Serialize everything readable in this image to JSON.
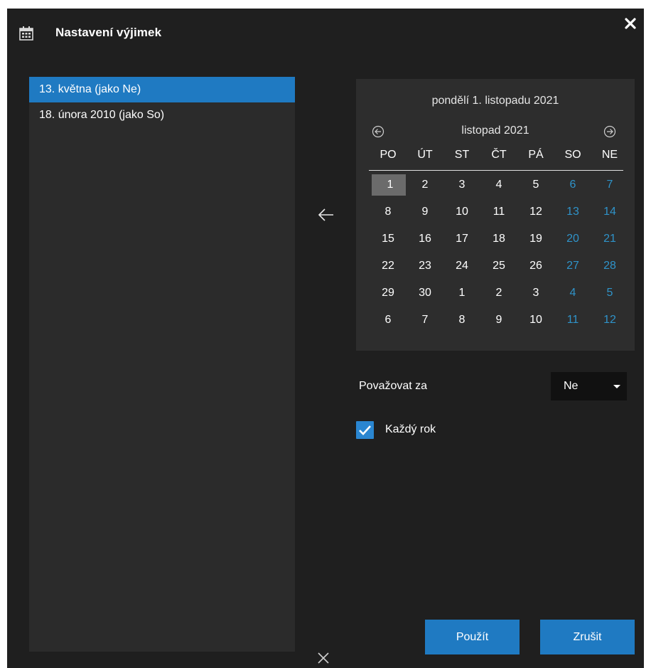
{
  "window": {
    "title": "Nastavení výjimek",
    "icon": "calendar-icon",
    "close_icon": "close-icon"
  },
  "exceptions": [
    {
      "label": "13. května (jako Ne)",
      "selected": true
    },
    {
      "label": "18. února 2010 (jako So)",
      "selected": false
    }
  ],
  "calendar": {
    "selected_date_text": "pondělí 1. listopadu 2021",
    "month_label": "listopad 2021",
    "prev_icon": "prev-month-icon",
    "next_icon": "next-month-icon",
    "weekdays": [
      "PO",
      "ÚT",
      "ST",
      "ČT",
      "PÁ",
      "SO",
      "NE"
    ],
    "weeks": [
      [
        "1",
        "2",
        "3",
        "4",
        "5",
        "6",
        "7"
      ],
      [
        "8",
        "9",
        "10",
        "11",
        "12",
        "13",
        "14"
      ],
      [
        "15",
        "16",
        "17",
        "18",
        "19",
        "20",
        "21"
      ],
      [
        "22",
        "23",
        "24",
        "25",
        "26",
        "27",
        "28"
      ],
      [
        "29",
        "30",
        "1",
        "2",
        "3",
        "4",
        "5"
      ],
      [
        "6",
        "7",
        "8",
        "9",
        "10",
        "11",
        "12"
      ]
    ],
    "today": "1",
    "weekend_color": "#2f93c9"
  },
  "form": {
    "consider_label": "Považovat za",
    "consider_value": "Ne",
    "every_year_label": "Každý rok",
    "every_year_checked": true
  },
  "buttons": {
    "apply": "Použít",
    "cancel": "Zrušit"
  },
  "colors": {
    "accent": "#1f7ac2",
    "background": "#1f1f1f",
    "panel": "#2b2b2b"
  }
}
